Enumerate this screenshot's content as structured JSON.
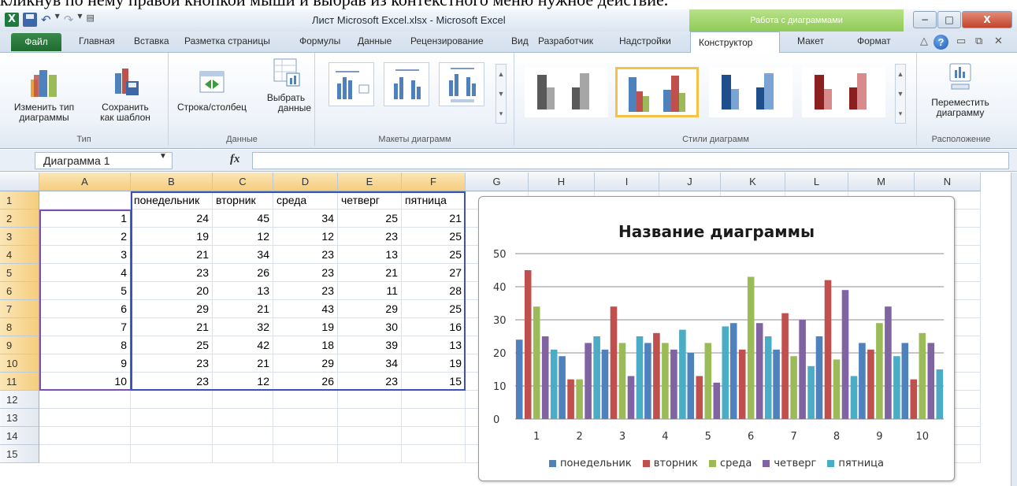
{
  "caption": "кликнув по нему правой кнопкой мыши и выбрав из контекстного меню нужное действие.",
  "window": {
    "title": "Лист Microsoft Excel.xlsx  -  Microsoft Excel",
    "context_header": "Работа с диаграммами",
    "minimize": "−",
    "restore": "□",
    "close": "X"
  },
  "tabs": {
    "file": "Файл",
    "items": [
      "Главная",
      "Вставка",
      "Разметка страницы",
      "Формулы",
      "Данные",
      "Рецензирование",
      "Вид",
      "Разработчик",
      "Надстройки"
    ],
    "context": [
      "Конструктор",
      "Макет",
      "Формат"
    ],
    "active": "Конструктор"
  },
  "ribbon": {
    "change_type": [
      "Изменить тип",
      "диаграммы"
    ],
    "save_template": [
      "Сохранить",
      "как шаблон"
    ],
    "group_type": "Тип",
    "row_col": [
      "Строка/столбец",
      ""
    ],
    "select_data": [
      "Выбрать",
      "данные"
    ],
    "group_data": "Данные",
    "group_layouts": "Макеты диаграмм",
    "group_styles": "Стили диаграмм",
    "move_chart": [
      "Переместить",
      "диаграмму"
    ],
    "group_location": "Расположение"
  },
  "formula_bar": {
    "name_box": "Диаграмма 1",
    "fx": "fx",
    "value": ""
  },
  "columns": [
    "A",
    "B",
    "C",
    "D",
    "E",
    "F",
    "G",
    "H",
    "I",
    "J",
    "K",
    "L",
    "M",
    "N"
  ],
  "rows": [
    "1",
    "2",
    "3",
    "4",
    "5",
    "6",
    "7",
    "8",
    "9",
    "10",
    "11",
    "12",
    "13",
    "14",
    "15"
  ],
  "table": {
    "header": [
      "",
      "понедельник",
      "вторник",
      "среда",
      "четверг",
      "пятница"
    ],
    "data": [
      [
        "1",
        "24",
        "45",
        "34",
        "25",
        "21"
      ],
      [
        "2",
        "19",
        "12",
        "12",
        "23",
        "25"
      ],
      [
        "3",
        "21",
        "34",
        "23",
        "13",
        "25"
      ],
      [
        "4",
        "23",
        "26",
        "23",
        "21",
        "27"
      ],
      [
        "5",
        "20",
        "13",
        "23",
        "11",
        "28"
      ],
      [
        "6",
        "29",
        "21",
        "43",
        "29",
        "25"
      ],
      [
        "7",
        "21",
        "32",
        "19",
        "30",
        "16"
      ],
      [
        "8",
        "25",
        "42",
        "18",
        "39",
        "13"
      ],
      [
        "9",
        "23",
        "21",
        "29",
        "34",
        "19"
      ],
      [
        "10",
        "23",
        "12",
        "26",
        "23",
        "15"
      ]
    ]
  },
  "colors": {
    "accent_green": "#1f6b32",
    "series": [
      "#4f81bd",
      "#c0504d",
      "#9bbb59",
      "#8064a2",
      "#4bacc6"
    ]
  },
  "chart_data": {
    "type": "bar",
    "title": "Название диаграммы",
    "xlabel": "",
    "ylabel": "",
    "categories": [
      "1",
      "2",
      "3",
      "4",
      "5",
      "6",
      "7",
      "8",
      "9",
      "10"
    ],
    "ylim": [
      0,
      50
    ],
    "yticks": [
      "0",
      "10",
      "20",
      "30",
      "40",
      "50"
    ],
    "grid": true,
    "legend": "bottom",
    "series": [
      {
        "name": "понедельник",
        "values": [
          24,
          19,
          21,
          23,
          20,
          29,
          21,
          25,
          23,
          23
        ]
      },
      {
        "name": "вторник",
        "values": [
          45,
          12,
          34,
          26,
          13,
          21,
          32,
          42,
          21,
          12
        ]
      },
      {
        "name": "среда",
        "values": [
          34,
          12,
          23,
          23,
          23,
          43,
          19,
          18,
          29,
          26
        ]
      },
      {
        "name": "четверг",
        "values": [
          25,
          23,
          13,
          21,
          11,
          29,
          30,
          39,
          34,
          23
        ]
      },
      {
        "name": "пятница",
        "values": [
          21,
          25,
          25,
          27,
          28,
          25,
          16,
          13,
          19,
          15
        ]
      }
    ]
  }
}
